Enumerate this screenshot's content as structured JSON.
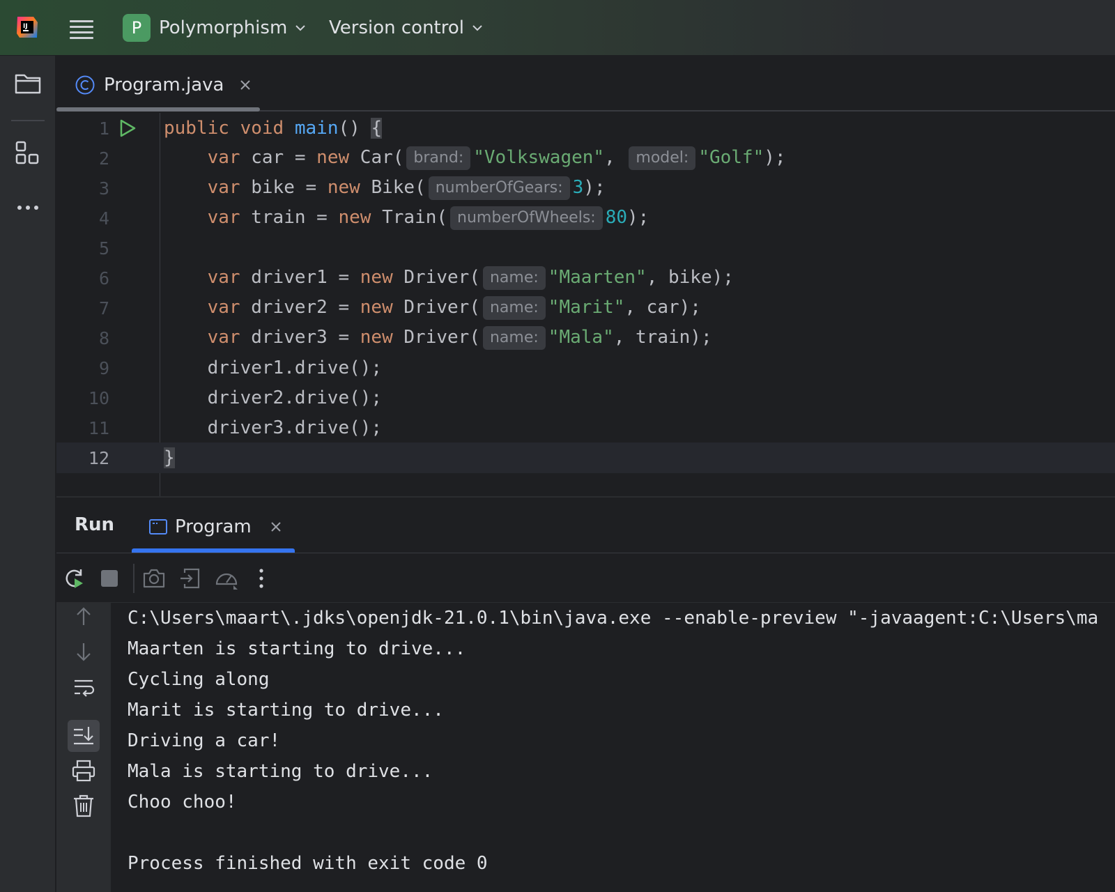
{
  "titlebar": {
    "project_badge": "P",
    "project_name": "Polymorphism",
    "vcs_label": "Version control"
  },
  "editor": {
    "tab_label": "Program.java",
    "lines": [
      {
        "n": "1"
      },
      {
        "n": "2"
      },
      {
        "n": "3"
      },
      {
        "n": "4"
      },
      {
        "n": "5"
      },
      {
        "n": "6"
      },
      {
        "n": "7"
      },
      {
        "n": "8"
      },
      {
        "n": "9"
      },
      {
        "n": "10"
      },
      {
        "n": "11"
      },
      {
        "n": "12"
      }
    ],
    "code": {
      "l1": {
        "kw1": "public",
        "kw2": "void",
        "fn": "main",
        "rest": "() ",
        "brace": "{"
      },
      "l2": {
        "kw1": "var",
        "mid1": " car = ",
        "kw2": "new",
        "mid2": " Car(",
        "hint1": "brand:",
        "str1": "\"Volkswagen\"",
        "mid3": ", ",
        "hint2": "model:",
        "str2": "\"Golf\"",
        "end": ");"
      },
      "l3": {
        "kw1": "var",
        "mid1": " bike = ",
        "kw2": "new",
        "mid2": " Bike(",
        "hint1": "numberOfGears:",
        "num": "3",
        "end": ");"
      },
      "l4": {
        "kw1": "var",
        "mid1": " train = ",
        "kw2": "new",
        "mid2": " Train(",
        "hint1": "numberOfWheels:",
        "num": "80",
        "end": ");"
      },
      "l6": {
        "kw1": "var",
        "mid1": " driver1 = ",
        "kw2": "new",
        "mid2": " Driver(",
        "hint1": "name:",
        "str1": "\"Maarten\"",
        "end": ", bike);"
      },
      "l7": {
        "kw1": "var",
        "mid1": " driver2 = ",
        "kw2": "new",
        "mid2": " Driver(",
        "hint1": "name:",
        "str1": "\"Marit\"",
        "end": ", car);"
      },
      "l8": {
        "kw1": "var",
        "mid1": " driver3 = ",
        "kw2": "new",
        "mid2": " Driver(",
        "hint1": "name:",
        "str1": "\"Mala\"",
        "end": ", train);"
      },
      "l9": "driver1.drive();",
      "l10": "driver2.drive();",
      "l11": "driver3.drive();",
      "l12": "}"
    }
  },
  "run": {
    "title": "Run",
    "tab_label": "Program",
    "console": [
      "C:\\Users\\maart\\.jdks\\openjdk-21.0.1\\bin\\java.exe --enable-preview \"-javaagent:C:\\Users\\ma",
      "Maarten is starting to drive...",
      "Cycling along",
      "Marit is starting to drive...",
      "Driving a car!",
      "Mala is starting to drive...",
      "Choo choo!",
      "",
      "Process finished with exit code 0"
    ]
  },
  "colors": {
    "keyword": "#cf8e6d",
    "function": "#56a8f5",
    "string": "#6aab73",
    "number": "#2aacb8",
    "accent": "#3574f0",
    "run_green": "#5fb865"
  },
  "icons": [
    "intellij-logo-icon",
    "hamburger-menu-icon",
    "chevron-down-icon",
    "folder-icon",
    "structure-icon",
    "more-icon",
    "class-icon",
    "close-icon",
    "run-gutter-icon",
    "console-tab-icon",
    "rerun-icon",
    "stop-icon",
    "screenshot-icon",
    "exit-icon",
    "profiler-icon",
    "kebab-menu-icon",
    "scroll-up-icon",
    "scroll-down-icon",
    "soft-wrap-icon",
    "scroll-to-end-icon",
    "print-icon",
    "trash-icon"
  ]
}
